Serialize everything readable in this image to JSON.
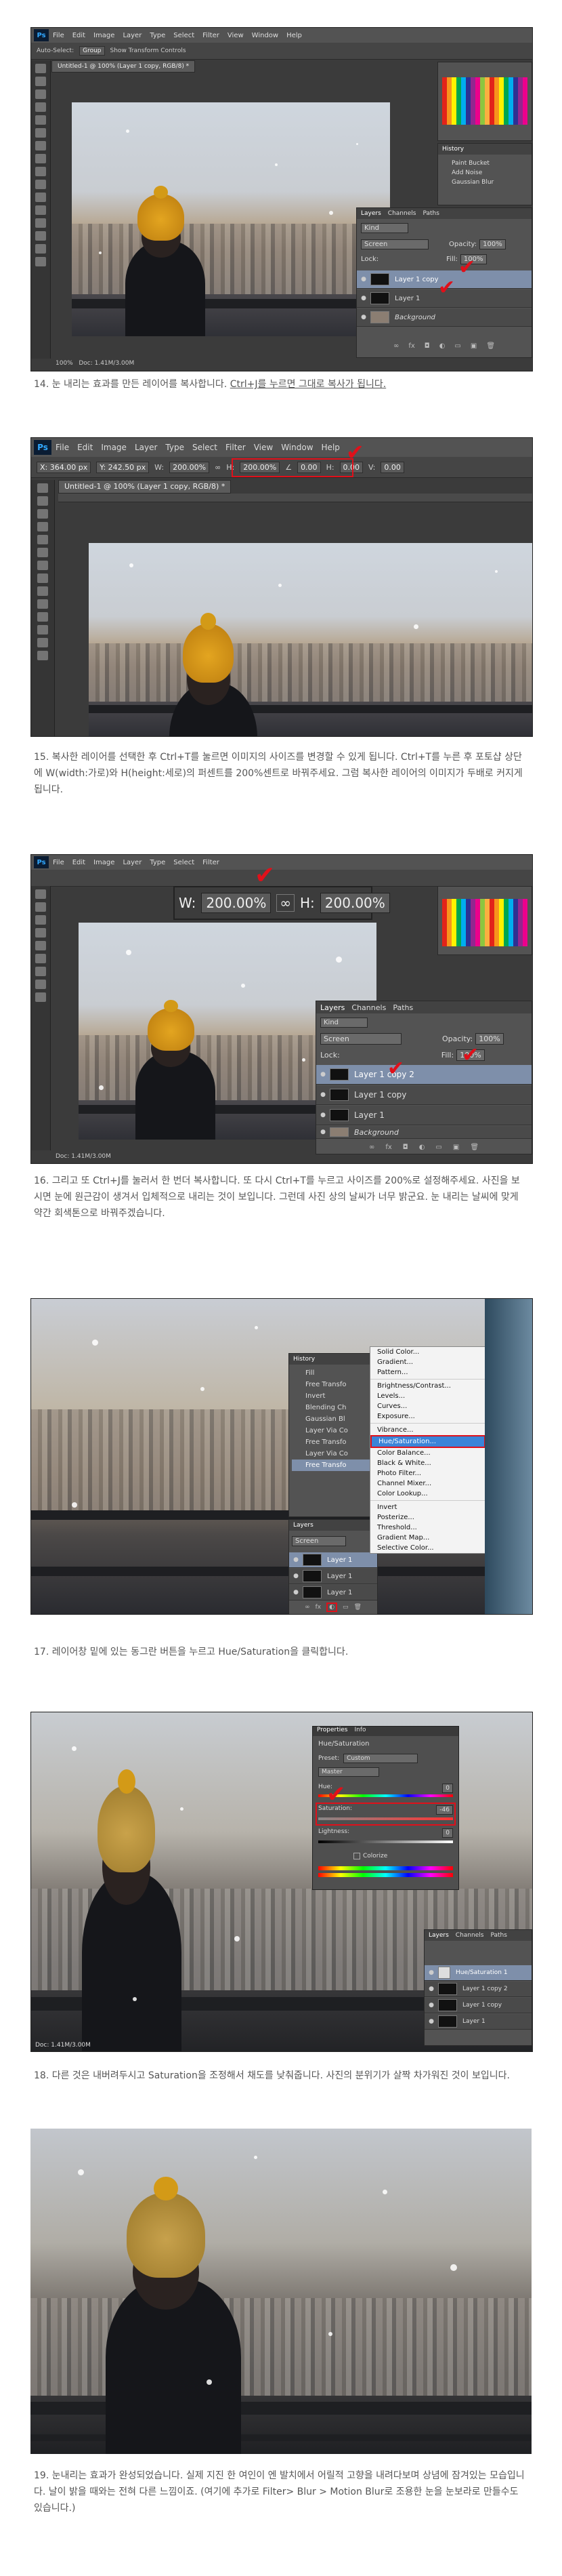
{
  "captions": {
    "step14_main": "14. 눈 내리는 효과를 만든 레이어를 복사합니다. ",
    "step14_link": "Ctrl+J를 누르면 그대로 복사가 됩니다.",
    "step15": "15. 복사한 레이어를 선택한 후 Ctrl+T를 눌르면 이미지의 사이즈를 변경할 수 있게 됩니다. Ctrl+T를 누른 후 포토샵 상단에 W(width:가로)와 H(height:세로)의 퍼센트를 200%센트로 바꿔주세요. 그럼 복사한 레이어의 이미지가 두배로 커지게 됩니다.",
    "step16": "16. 그리고 또 Ctrl+J를 눌러서 한 번더 복사합니다. 또 다시 Ctrl+T를 누르고 사이즈를 200%로 설정해주세요. 사진을 보시면 눈에 원근감이 생겨서 입체적으로 내리는 것이 보입니다. 그런데 사진 상의 날씨가 너무 밝군요. 눈 내리는 날씨에 맞게 약간 회색톤으로 바꿔주겠습니다.",
    "step17": "17. 레이어창 밑에 있는 동그란 버튼을 누르고 Hue/Saturation을 클릭합니다.",
    "step18": "18. 다른 것은 내버려두시고 Saturation을 조정해서 채도를 낮춰줍니다. 사진의 분위기가 살짝 차가워진 것이 보입니다.",
    "step19": "19. 눈내리는 효과가 완성되었습니다. 실제 지진 한 여인이 엔 발치에서 어릴적 고향을 내려다보며 상념에 잠겨있는 모습입니다. 날이 밝을 때와는 전혀 다른 느낌이죠. (여기에 추가로 Filter> Blur > Motion Blur로 조용한 눈을 눈보라로 만들수도 있습니다.)"
  },
  "menu": [
    "File",
    "Edit",
    "Image",
    "Layer",
    "Type",
    "Select",
    "Filter",
    "View",
    "Window",
    "Help"
  ],
  "shot1": {
    "doc_tab": "Untitled-1 @ 100% (Layer 1 copy, RGB/8) *",
    "options": [
      "Auto-Select:",
      "Group",
      "Show Transform Controls"
    ],
    "layers_tabs": [
      "Layers",
      "Channels",
      "Paths"
    ],
    "kind": "Kind",
    "blend": "Screen",
    "opacity_label": "Opacity:",
    "opacity": "100%",
    "lock_label": "Lock:",
    "fill_label": "Fill:",
    "fill": "100%",
    "layers": [
      "Layer 1 copy",
      "Layer 1",
      "Background"
    ],
    "status": "Doc: 1.41M/3.00M",
    "zoom": "100%",
    "history_items": [
      "Paint Bucket",
      "Add Noise",
      "Gaussian Blur"
    ]
  },
  "shot2": {
    "doc_tab": "Untitled-1 @ 100% (Layer 1 copy, RGB/8) *",
    "x": "X: 364.00 px",
    "y": "Y: 242.50 px",
    "w_label": "W:",
    "w": "200.00%",
    "h_label": "H:",
    "h": "200.00%",
    "angle": "0.00",
    "h2": "0.00",
    "v": "0.00"
  },
  "shot3": {
    "zoom_w_label": "W:",
    "zoom_w": "200.00%",
    "zoom_h_label": "H:",
    "zoom_h": "200.00%",
    "layers_tabs": [
      "Layers",
      "Channels",
      "Paths"
    ],
    "kind": "Kind",
    "blend": "Screen",
    "opacity_label": "Opacity:",
    "opacity": "100%",
    "lock_label": "Lock:",
    "fill_label": "Fill:",
    "fill": "100%",
    "layers": [
      "Layer 1 copy 2",
      "Layer 1 copy",
      "Layer 1",
      "Background"
    ],
    "status": "Doc: 1.41M/3.00M"
  },
  "shot4": {
    "history_title": "History",
    "history_items": [
      "Fill",
      "Free Transfo",
      "Invert",
      "Blending Ch",
      "Gaussian Bl",
      "Layer Via Co",
      "Free Transfo",
      "Layer Via Co",
      "Free Transfo"
    ],
    "layers_title": "Layers",
    "blend": "Screen",
    "layers": [
      "Layer 1",
      "Layer 1",
      "Layer 1"
    ],
    "menu_items": [
      "Solid Color...",
      "Gradient...",
      "Pattern...",
      "-",
      "Brightness/Contrast...",
      "Levels...",
      "Curves...",
      "Exposure...",
      "-",
      "Vibrance...",
      "Hue/Saturation...",
      "Color Balance...",
      "Black & White...",
      "Photo Filter...",
      "Channel Mixer...",
      "Color Lookup...",
      "-",
      "Invert",
      "Posterize...",
      "Threshold...",
      "Gradient Map...",
      "Selective Color..."
    ],
    "highlighted": "Hue/Saturation..."
  },
  "shot5": {
    "title_tabs": [
      "Properties",
      "Info"
    ],
    "header": "Hue/Saturation",
    "preset_label": "Preset:",
    "preset": "Custom",
    "channel": "Master",
    "hue_label": "Hue:",
    "hue": "0",
    "sat_label": "Saturation:",
    "sat": "-46",
    "light_label": "Lightness:",
    "light": "0",
    "colorize": "Colorize",
    "layers": [
      "Hue/Saturation 1",
      "Layer 1 copy 2",
      "Layer 1 copy",
      "Layer 1"
    ],
    "status": "Doc: 1.41M/3.00M"
  },
  "colors": {
    "ps_bg": "#3b3b3b",
    "panel": "#535353",
    "selected_layer": "#7e8faa",
    "red_mark": "#e0101a",
    "menu_highlight": "#3b84d8"
  }
}
